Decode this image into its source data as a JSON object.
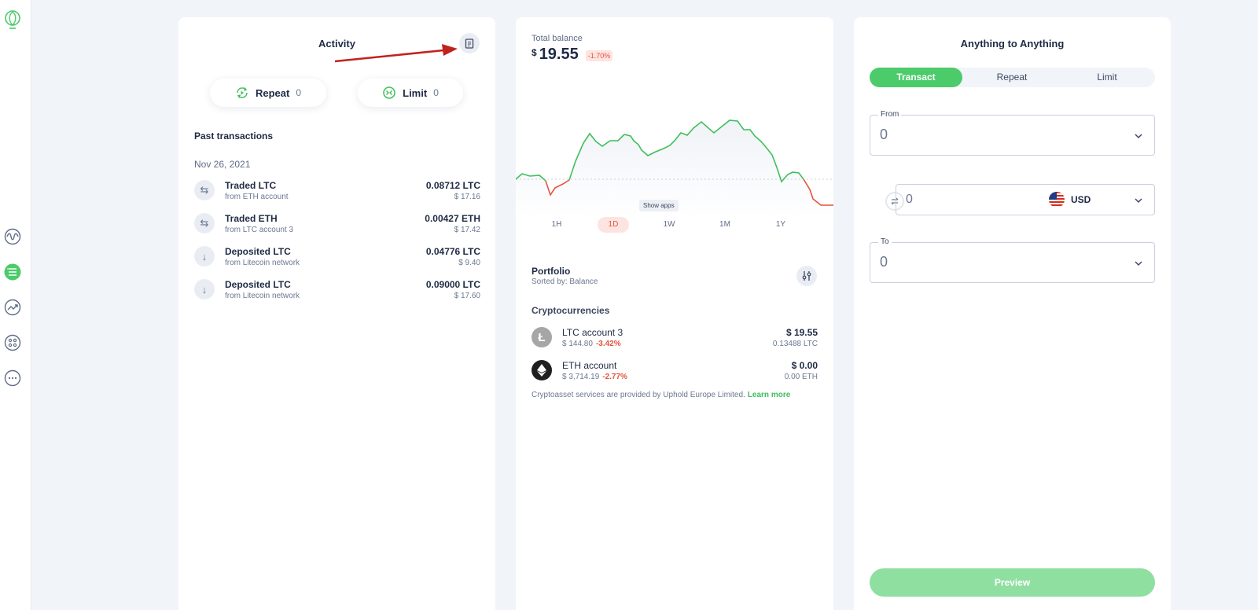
{
  "sidebar": {
    "items": [
      {
        "name": "activity-wave-icon"
      },
      {
        "name": "transactions-list-icon",
        "active": true
      },
      {
        "name": "trending-icon"
      },
      {
        "name": "apps-grid-icon"
      },
      {
        "name": "more-dots-icon"
      }
    ]
  },
  "activity": {
    "title": "Activity",
    "repeat": {
      "label": "Repeat",
      "count": "0"
    },
    "limit": {
      "label": "Limit",
      "count": "0"
    },
    "past_title": "Past transactions",
    "date": "Nov 26, 2021",
    "transactions": [
      {
        "title": "Traded LTC",
        "subtitle": "from ETH account",
        "amount": "0.08712 LTC",
        "fiat": "$ 17.16",
        "icon": "swap-arrows-icon"
      },
      {
        "title": "Traded ETH",
        "subtitle": "from LTC account 3",
        "amount": "0.00427 ETH",
        "fiat": "$ 17.42",
        "icon": "swap-arrows-icon"
      },
      {
        "title": "Deposited LTC",
        "subtitle": "from Litecoin network",
        "amount": "0.04776 LTC",
        "fiat": "$ 9.40",
        "icon": "arrow-down-icon"
      },
      {
        "title": "Deposited LTC",
        "subtitle": "from Litecoin network",
        "amount": "0.09000 LTC",
        "fiat": "$ 17.60",
        "icon": "arrow-down-icon"
      }
    ]
  },
  "balance": {
    "label": "Total balance",
    "currency_symbol": "$",
    "value": "19.55",
    "change": "-1.70%",
    "tooltip": "Show apps",
    "ranges": [
      "1H",
      "1D",
      "1W",
      "1M",
      "1Y"
    ],
    "active_range": "1D",
    "colors": {
      "up": "#3fbf5c",
      "down": "#e5533d"
    }
  },
  "portfolio": {
    "title": "Portfolio",
    "sorted_by": "Sorted by: Balance",
    "section": "Cryptocurrencies",
    "assets": [
      {
        "name": "LTC account 3",
        "price": "$ 144.80",
        "change": "-3.42%",
        "value": "$ 19.55",
        "qty": "0.13488 LTC",
        "icon": "litecoin-icon"
      },
      {
        "name": "ETH account",
        "price": "$ 3,714.19",
        "change": "-2.77%",
        "value": "$ 0.00",
        "qty": "0.00 ETH",
        "icon": "ethereum-icon"
      }
    ],
    "disclaimer": "Cryptoasset services are provided by Uphold Europe Limited.",
    "learn_more": "Learn more"
  },
  "ata": {
    "title": "Anything to Anything",
    "tabs": [
      "Transact",
      "Repeat",
      "Limit"
    ],
    "active_tab": "Transact",
    "from": {
      "label": "From",
      "value": "0"
    },
    "amount": {
      "value": "0",
      "currency": "USD"
    },
    "to": {
      "label": "To",
      "value": "0"
    },
    "preview_label": "Preview"
  }
}
